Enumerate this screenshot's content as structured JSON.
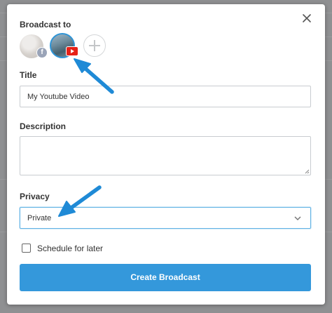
{
  "header": {
    "label": "Broadcast to"
  },
  "accounts": [
    {
      "name": "facebook-account",
      "badge": "f"
    },
    {
      "name": "youtube-account",
      "badge": "youtube-play"
    }
  ],
  "title_field": {
    "label": "Title",
    "value": "My Youtube Video"
  },
  "description_field": {
    "label": "Description",
    "value": ""
  },
  "privacy_field": {
    "label": "Privacy",
    "selected": "Private"
  },
  "schedule": {
    "label": "Schedule for later",
    "checked": false
  },
  "actions": {
    "create_label": "Create Broadcast"
  },
  "colors": {
    "accent": "#3498db",
    "arrow": "#1f8ad6",
    "youtube": "#e62117"
  },
  "icons": [
    "close-icon",
    "plus-icon",
    "facebook-icon",
    "youtube-icon",
    "chevron-down-icon",
    "annotation-arrow"
  ]
}
